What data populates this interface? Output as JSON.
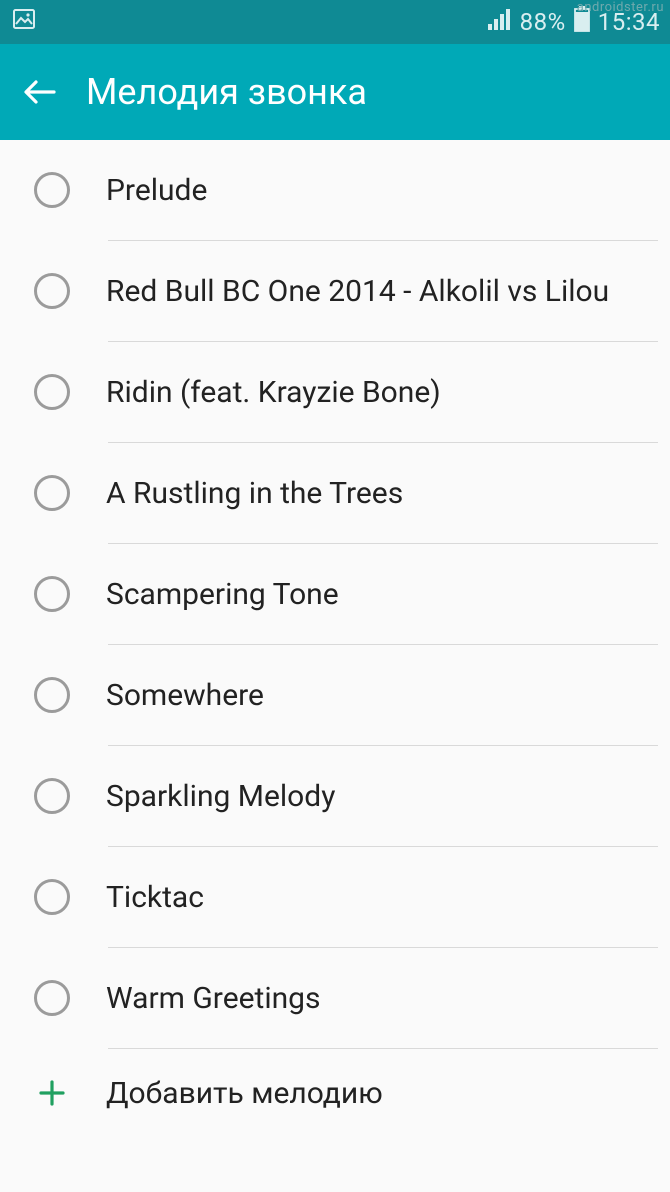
{
  "statusbar": {
    "battery_percent": "88%",
    "time": "15:34",
    "watermark": "androidster.ru"
  },
  "header": {
    "title": "Мелодия звонка"
  },
  "ringtones": [
    {
      "label": "Prelude"
    },
    {
      "label": "Red Bull BC One 2014 - Alkolil vs Lilou"
    },
    {
      "label": "Ridin (feat. Krayzie Bone)"
    },
    {
      "label": "A Rustling in the Trees"
    },
    {
      "label": "Scampering Tone"
    },
    {
      "label": "Somewhere"
    },
    {
      "label": "Sparkling Melody"
    },
    {
      "label": "Ticktac"
    },
    {
      "label": "Warm Greetings"
    }
  ],
  "add": {
    "label": "Добавить мелодию"
  }
}
